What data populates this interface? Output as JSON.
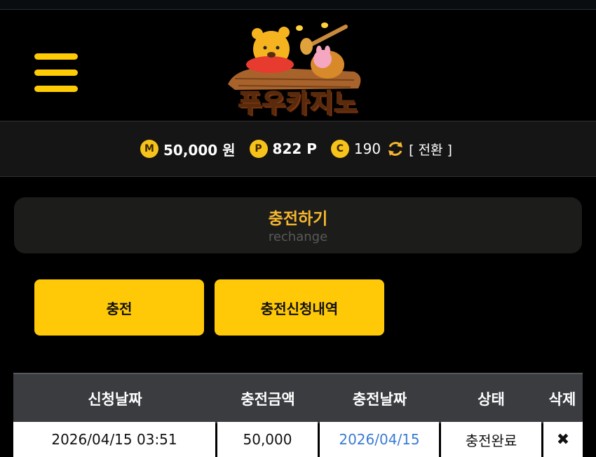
{
  "header": {
    "logo_text": "푸우카지노",
    "menu_icon": "hamburger-menu-icon"
  },
  "balance": {
    "money_badge": "M",
    "money": "50,000 원",
    "point_badge": "P",
    "point": "822 P",
    "coin_badge": "C",
    "coin": "190",
    "refresh_icon": "refresh-icon",
    "convert_label": "[ 전환 ]",
    "coin_color": "#f7c21a"
  },
  "section": {
    "title": "충전하기",
    "subtitle": "rechange"
  },
  "actions": {
    "charge_label": "충전",
    "history_label": "충전신청내역"
  },
  "table": {
    "headers": [
      "신청날짜",
      "충전금액",
      "충전날짜",
      "상태",
      "삭제"
    ],
    "rows": [
      {
        "request_date": "2026/04/15 03:51",
        "amount": "50,000",
        "charge_date": "2026/04/15",
        "status": "충전완료",
        "delete": "✖"
      }
    ]
  },
  "colors": {
    "accent": "#ffc907",
    "title": "#f7b731",
    "link": "#3a7bd5"
  }
}
